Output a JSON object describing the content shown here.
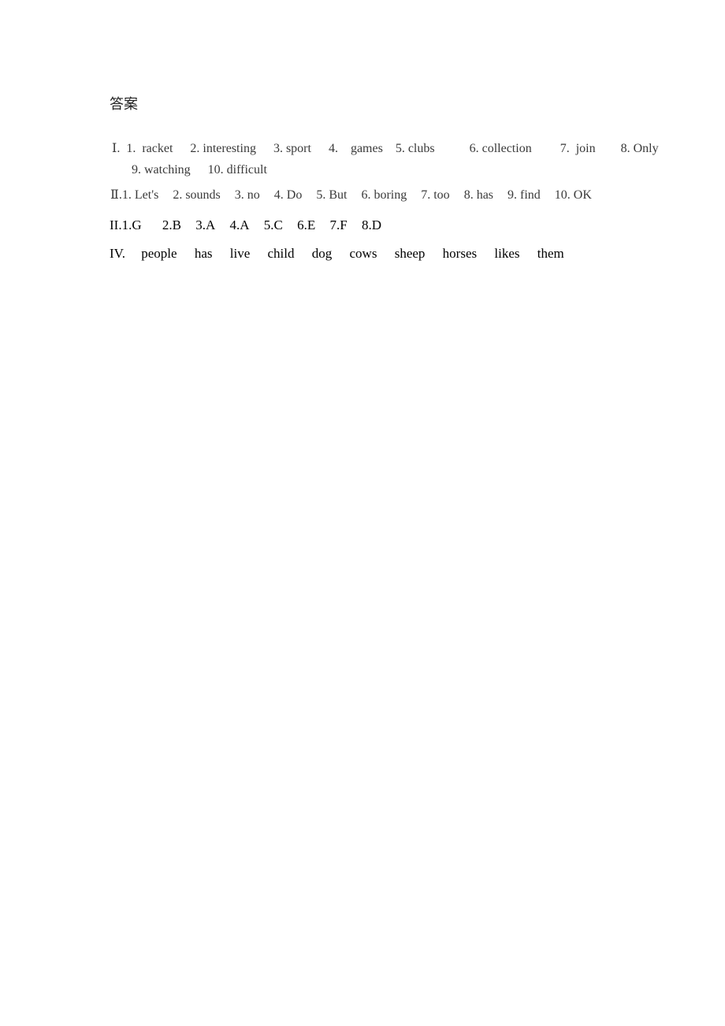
{
  "title": "答案",
  "section1": {
    "label": "Ⅰ.",
    "items": [
      {
        "num": "1.",
        "ans": "racket"
      },
      {
        "num": "2.",
        "ans": "interesting"
      },
      {
        "num": "3.",
        "ans": "sport"
      },
      {
        "num": "4.",
        "ans": "games"
      },
      {
        "num": "5.",
        "ans": "clubs"
      },
      {
        "num": "6.",
        "ans": "collection"
      },
      {
        "num": "7.",
        "ans": "join"
      },
      {
        "num": "8.",
        "ans": "Only"
      },
      {
        "num": "9.",
        "ans": "watching"
      },
      {
        "num": "10.",
        "ans": "difficult"
      }
    ]
  },
  "section2": {
    "label": "Ⅱ.",
    "items": [
      {
        "num": "1.",
        "ans": "Let's"
      },
      {
        "num": "2.",
        "ans": "sounds"
      },
      {
        "num": "3.",
        "ans": "no"
      },
      {
        "num": "4.",
        "ans": "Do"
      },
      {
        "num": "5.",
        "ans": "But"
      },
      {
        "num": "6.",
        "ans": "boring"
      },
      {
        "num": "7.",
        "ans": "too"
      },
      {
        "num": "8.",
        "ans": "has"
      },
      {
        "num": "9.",
        "ans": "find"
      },
      {
        "num": "10.",
        "ans": "OK"
      }
    ]
  },
  "section3": {
    "label": "II.",
    "items": [
      "1.G",
      "2.B",
      "3.A",
      "4.A",
      "5.C",
      "6.E",
      "7.F",
      "8.D"
    ]
  },
  "section4": {
    "label": "IV.",
    "items": [
      "people",
      "has",
      "live",
      "child",
      "dog",
      "cows",
      "sheep",
      "horses",
      "likes",
      "them"
    ]
  }
}
